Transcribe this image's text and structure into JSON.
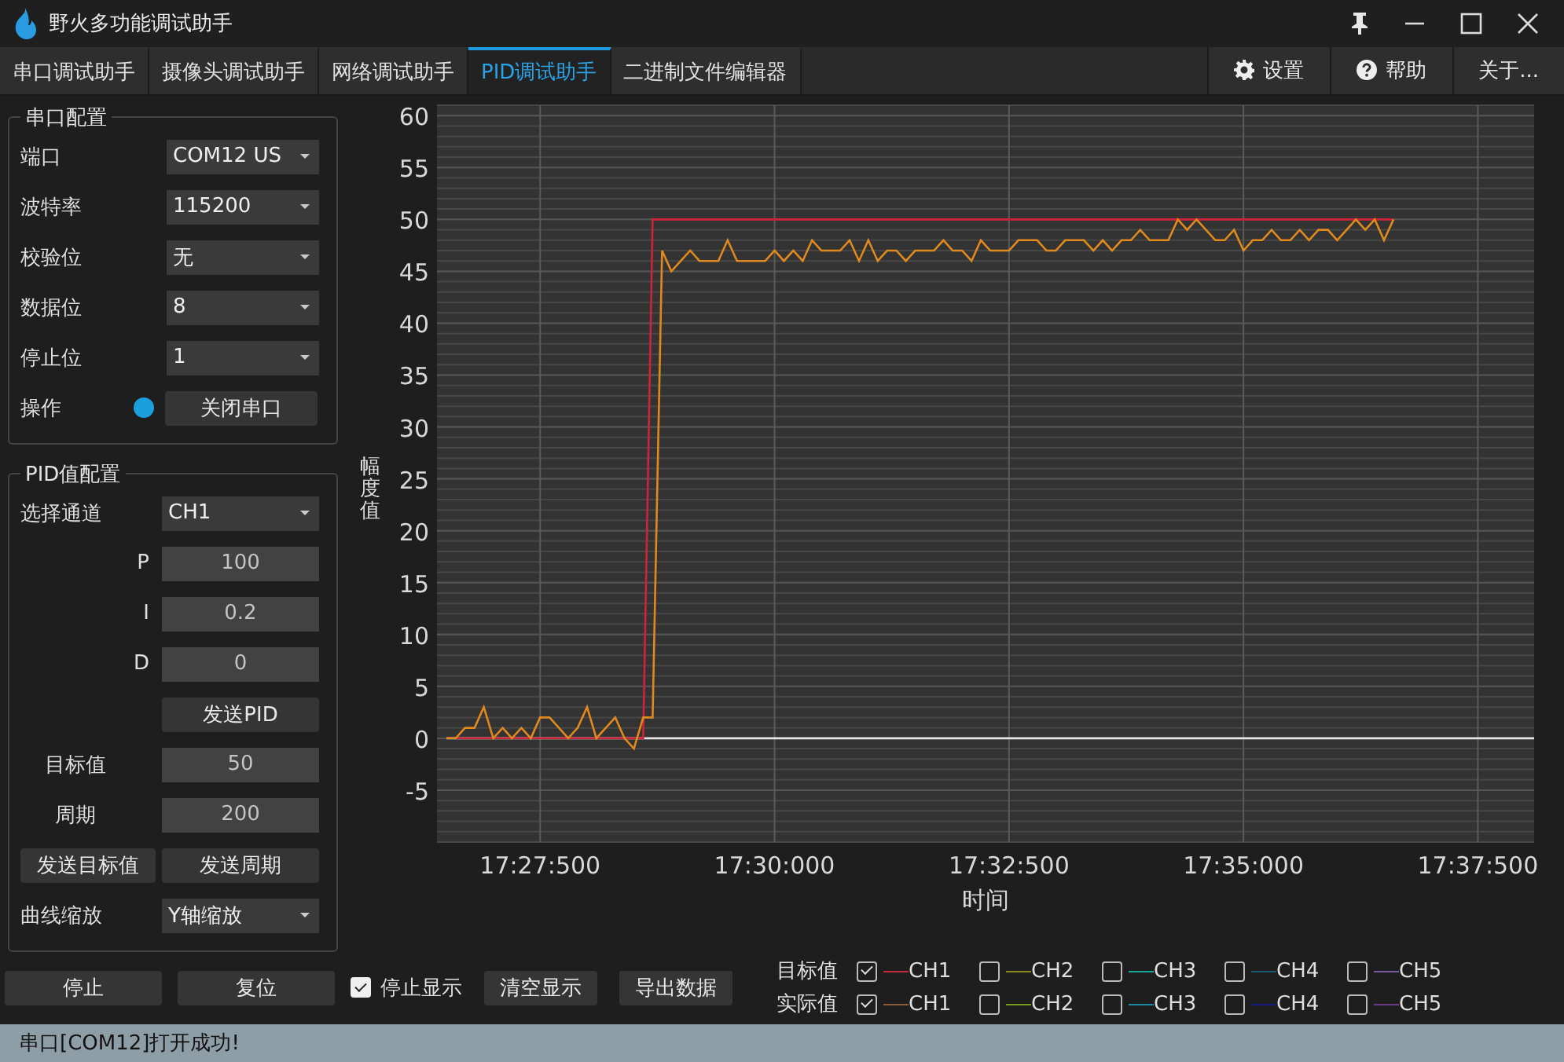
{
  "window": {
    "title": "野火多功能调试助手"
  },
  "tabs": [
    {
      "label": "串口调试助手",
      "selected": false
    },
    {
      "label": "摄像头调试助手",
      "selected": false
    },
    {
      "label": "网络调试助手",
      "selected": false
    },
    {
      "label": "PID调试助手",
      "selected": true
    },
    {
      "label": "二进制文件编辑器",
      "selected": false
    }
  ],
  "menu_buttons": [
    {
      "kind": "settings",
      "label": "设置"
    },
    {
      "kind": "help",
      "label": "帮助"
    },
    {
      "kind": "plain",
      "label": "关于..."
    }
  ],
  "serial_config": {
    "title": "串口配置",
    "fields": [
      {
        "label": "端口",
        "value": "COM12 US"
      },
      {
        "label": "波特率",
        "value": "115200"
      },
      {
        "label": "校验位",
        "value": "无"
      },
      {
        "label": "数据位",
        "value": "8"
      },
      {
        "label": "停止位",
        "value": "1"
      }
    ],
    "operation": {
      "label": "操作",
      "connected": true,
      "button": "关闭串口"
    }
  },
  "pid_config": {
    "title": "PID值配置",
    "channel": {
      "label": "选择通道",
      "value": "CH1"
    },
    "params": [
      {
        "label": "P",
        "value": "100"
      },
      {
        "label": "I",
        "value": "0.2"
      },
      {
        "label": "D",
        "value": "0"
      }
    ],
    "send_pid": "发送PID",
    "target": {
      "label": "目标值",
      "value": "50"
    },
    "period": {
      "label": "周期",
      "value": "200"
    },
    "send_target": "发送目标值",
    "send_period": "发送周期",
    "zoom": {
      "label": "曲线缩放",
      "value": "Y轴缩放"
    }
  },
  "controls": {
    "stop": "停止",
    "reset": "复位",
    "pause_display": {
      "label": "停止显示",
      "checked": true
    },
    "clear": "清空显示",
    "export": "导出数据"
  },
  "legend": [
    {
      "label": "目标值",
      "channels": [
        {
          "name": "CH1",
          "checked": true,
          "color": "#c8283c"
        },
        {
          "name": "CH2",
          "checked": false,
          "color": "#8a8a1e"
        },
        {
          "name": "CH3",
          "checked": false,
          "color": "#1aa89a"
        },
        {
          "name": "CH4",
          "checked": false,
          "color": "#1f5a70"
        },
        {
          "name": "CH5",
          "checked": false,
          "color": "#7a5a9a"
        }
      ]
    },
    {
      "label": "实际值",
      "channels": [
        {
          "name": "CH1",
          "checked": true,
          "color": "#8a5a3a"
        },
        {
          "name": "CH2",
          "checked": false,
          "color": "#7a9a1a"
        },
        {
          "name": "CH3",
          "checked": false,
          "color": "#1a8aa0"
        },
        {
          "name": "CH4",
          "checked": false,
          "color": "#1a1a8a"
        },
        {
          "name": "CH5",
          "checked": false,
          "color": "#6a3a8a"
        }
      ]
    }
  ],
  "chart_data": {
    "type": "line",
    "xlabel": "时间",
    "ylabel": "幅度值",
    "categories": [
      null,
      null,
      null,
      null,
      null,
      null,
      null,
      null,
      null,
      null,
      null,
      "17:27:500",
      null,
      null,
      null,
      null,
      null,
      null,
      null,
      null,
      null,
      null,
      null,
      null,
      null,
      null,
      null,
      null,
      null,
      null,
      null,
      null,
      null,
      null,
      null,
      null,
      "17:30:000",
      null,
      null,
      null,
      null,
      null,
      null,
      null,
      null,
      null,
      null,
      null,
      null,
      null,
      null,
      null,
      null,
      null,
      null,
      null,
      null,
      null,
      null,
      null,
      null,
      "17:32:500",
      null,
      null,
      null,
      null,
      null,
      null,
      null,
      null,
      null,
      null,
      null,
      null,
      null,
      null,
      null,
      null,
      null,
      null,
      null,
      null,
      null,
      null,
      null,
      null,
      "17:35:000",
      null,
      null,
      null,
      null,
      null,
      null,
      null,
      null,
      null,
      null,
      null,
      null,
      null,
      null,
      null,
      null,
      null,
      null,
      null,
      null,
      null,
      null,
      null,
      null,
      "17:37:500",
      null,
      null,
      null,
      null,
      null,
      null
    ],
    "series": [
      {
        "color": "#d0223a",
        "values": [
          null,
          0,
          0,
          0,
          0,
          0,
          0,
          0,
          0,
          0,
          0,
          0,
          0,
          0,
          0,
          0,
          0,
          0,
          0,
          0,
          0,
          0,
          0,
          50,
          50,
          50,
          50,
          50,
          50,
          50,
          50,
          50,
          50,
          50,
          50,
          50,
          50,
          50,
          50,
          50,
          50,
          50,
          50,
          50,
          50,
          50,
          50,
          50,
          50,
          50,
          50,
          50,
          50,
          50,
          50,
          50,
          50,
          50,
          50,
          50,
          50,
          50,
          50,
          50,
          50,
          50,
          50,
          50,
          50,
          50,
          50,
          50,
          50,
          50,
          50,
          50,
          50,
          50,
          50,
          50,
          50,
          50,
          50,
          50,
          50,
          50,
          50,
          50,
          50,
          50,
          50,
          50,
          50,
          50,
          50,
          50,
          50,
          50,
          50,
          50,
          50,
          50,
          50,
          null,
          null,
          null,
          null,
          null,
          null,
          null,
          null,
          null,
          null,
          null,
          null,
          null,
          null,
          null
        ]
      },
      {
        "color": "#e08a1e",
        "values": [
          null,
          0,
          0,
          1,
          1,
          3,
          0,
          1,
          0,
          1,
          0,
          2,
          2,
          1,
          0,
          1,
          3,
          0,
          1,
          2,
          0,
          -1,
          2,
          2,
          47,
          45,
          46,
          47,
          46,
          46,
          46,
          48,
          46,
          46,
          46,
          46,
          47,
          46,
          47,
          46,
          48,
          47,
          47,
          47,
          48,
          46,
          48,
          46,
          47,
          47,
          46,
          47,
          47,
          47,
          48,
          47,
          47,
          46,
          48,
          47,
          47,
          47,
          48,
          48,
          48,
          47,
          47,
          48,
          48,
          48,
          47,
          48,
          47,
          48,
          48,
          49,
          48,
          48,
          48,
          50,
          49,
          50,
          49,
          48,
          48,
          49,
          47,
          48,
          48,
          49,
          48,
          48,
          49,
          48,
          49,
          49,
          48,
          49,
          50,
          49,
          50,
          48,
          50,
          null,
          null,
          null,
          null,
          null,
          null,
          null,
          null,
          null,
          null,
          null,
          null,
          null,
          null,
          null
        ]
      }
    ],
    "ylim": [
      -10,
      61
    ],
    "grid": true,
    "yticks": [
      -5,
      0,
      5,
      10,
      15,
      20,
      25,
      30,
      35,
      40,
      45,
      50,
      55,
      60
    ]
  },
  "status_bar": "串口[COM12]打开成功!"
}
